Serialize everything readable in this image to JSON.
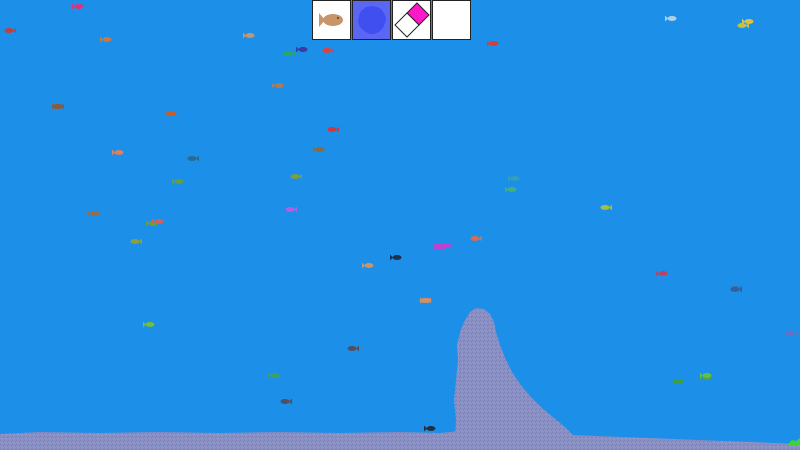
{
  "app": {
    "colors": {
      "water": "#1c8fe9",
      "sand": "#8a8fc4",
      "sand_dark": "#7379b0",
      "selected_tool": "#5b66f2"
    }
  },
  "toolbar": {
    "selected_index": 1,
    "tools": [
      {
        "name": "fish-tool",
        "icon": "fish-icon",
        "color": "#c8946a"
      },
      {
        "name": "sand-brush-tool",
        "icon": "blob-icon",
        "color": "#3f4ff0"
      },
      {
        "name": "eraser-tool",
        "icon": "eraser-icon",
        "color": "#ff18c8"
      },
      {
        "name": "empty-tool",
        "icon": "",
        "color": "#ffffff"
      }
    ]
  },
  "fish": [
    {
      "color": "#e0307a",
      "dir": 1
    },
    {
      "color": "#c47a40",
      "dir": 1
    },
    {
      "color": "#e04040",
      "dir": -1
    },
    {
      "color": "#c8946a",
      "dir": 1
    },
    {
      "color": "#2aa860",
      "dir": -1
    },
    {
      "color": "#3a3aa0",
      "dir": 1
    },
    {
      "color": "#d04040",
      "dir": 1
    },
    {
      "color": "#b07a50",
      "dir": 1
    },
    {
      "color": "#8a5a40",
      "dir": -1
    },
    {
      "color": "#c06030",
      "dir": 1
    },
    {
      "color": "#cc3a40",
      "dir": -1
    },
    {
      "color": "#d88060",
      "dir": 1
    },
    {
      "color": "#2a6a90",
      "dir": -1
    },
    {
      "color": "#8a6a40",
      "dir": 1
    },
    {
      "color": "#60a040",
      "dir": 1
    },
    {
      "color": "#7aa040",
      "dir": -1
    },
    {
      "color": "#a06a40",
      "dir": 1
    },
    {
      "color": "#8aa040",
      "dir": -1
    },
    {
      "color": "#6aa030",
      "dir": 1
    },
    {
      "color": "#b060e0",
      "dir": -1
    },
    {
      "color": "#d06060",
      "dir": 1
    },
    {
      "color": "#c040d0",
      "dir": -1
    },
    {
      "color": "#30a0c0",
      "dir": 1
    },
    {
      "color": "#c040d0",
      "dir": -1
    },
    {
      "color": "#40b080",
      "dir": 1
    },
    {
      "color": "#a0c040",
      "dir": -1
    },
    {
      "color": "#203050",
      "dir": 1
    },
    {
      "color": "#c040d0",
      "dir": 1
    },
    {
      "color": "#d07050",
      "dir": -1
    },
    {
      "color": "#c8946a",
      "dir": 1
    },
    {
      "color": "#d08a6a",
      "dir": -1
    },
    {
      "color": "#c04060",
      "dir": 1
    },
    {
      "color": "#4a6aa0",
      "dir": -1
    },
    {
      "color": "#c8946a",
      "dir": 1
    },
    {
      "color": "#70c040",
      "dir": 1
    },
    {
      "color": "#505060",
      "dir": -1
    },
    {
      "color": "#40a060",
      "dir": 1
    },
    {
      "color": "#6a70c0",
      "dir": -1
    },
    {
      "color": "#203040",
      "dir": 1
    },
    {
      "color": "#40a040",
      "dir": -1
    },
    {
      "color": "#50a040",
      "dir": 1
    },
    {
      "color": "#505060",
      "dir": -1
    },
    {
      "color": "#8a5a40",
      "dir": 1
    },
    {
      "color": "#60c040",
      "dir": 1
    },
    {
      "color": "#c8c040",
      "dir": -1
    },
    {
      "color": "#b0d0e0",
      "dir": 1
    },
    {
      "color": "#3060a0",
      "dir": -1
    },
    {
      "color": "#e0c040",
      "dir": 1
    },
    {
      "color": "#c04040",
      "dir": -1
    }
  ]
}
